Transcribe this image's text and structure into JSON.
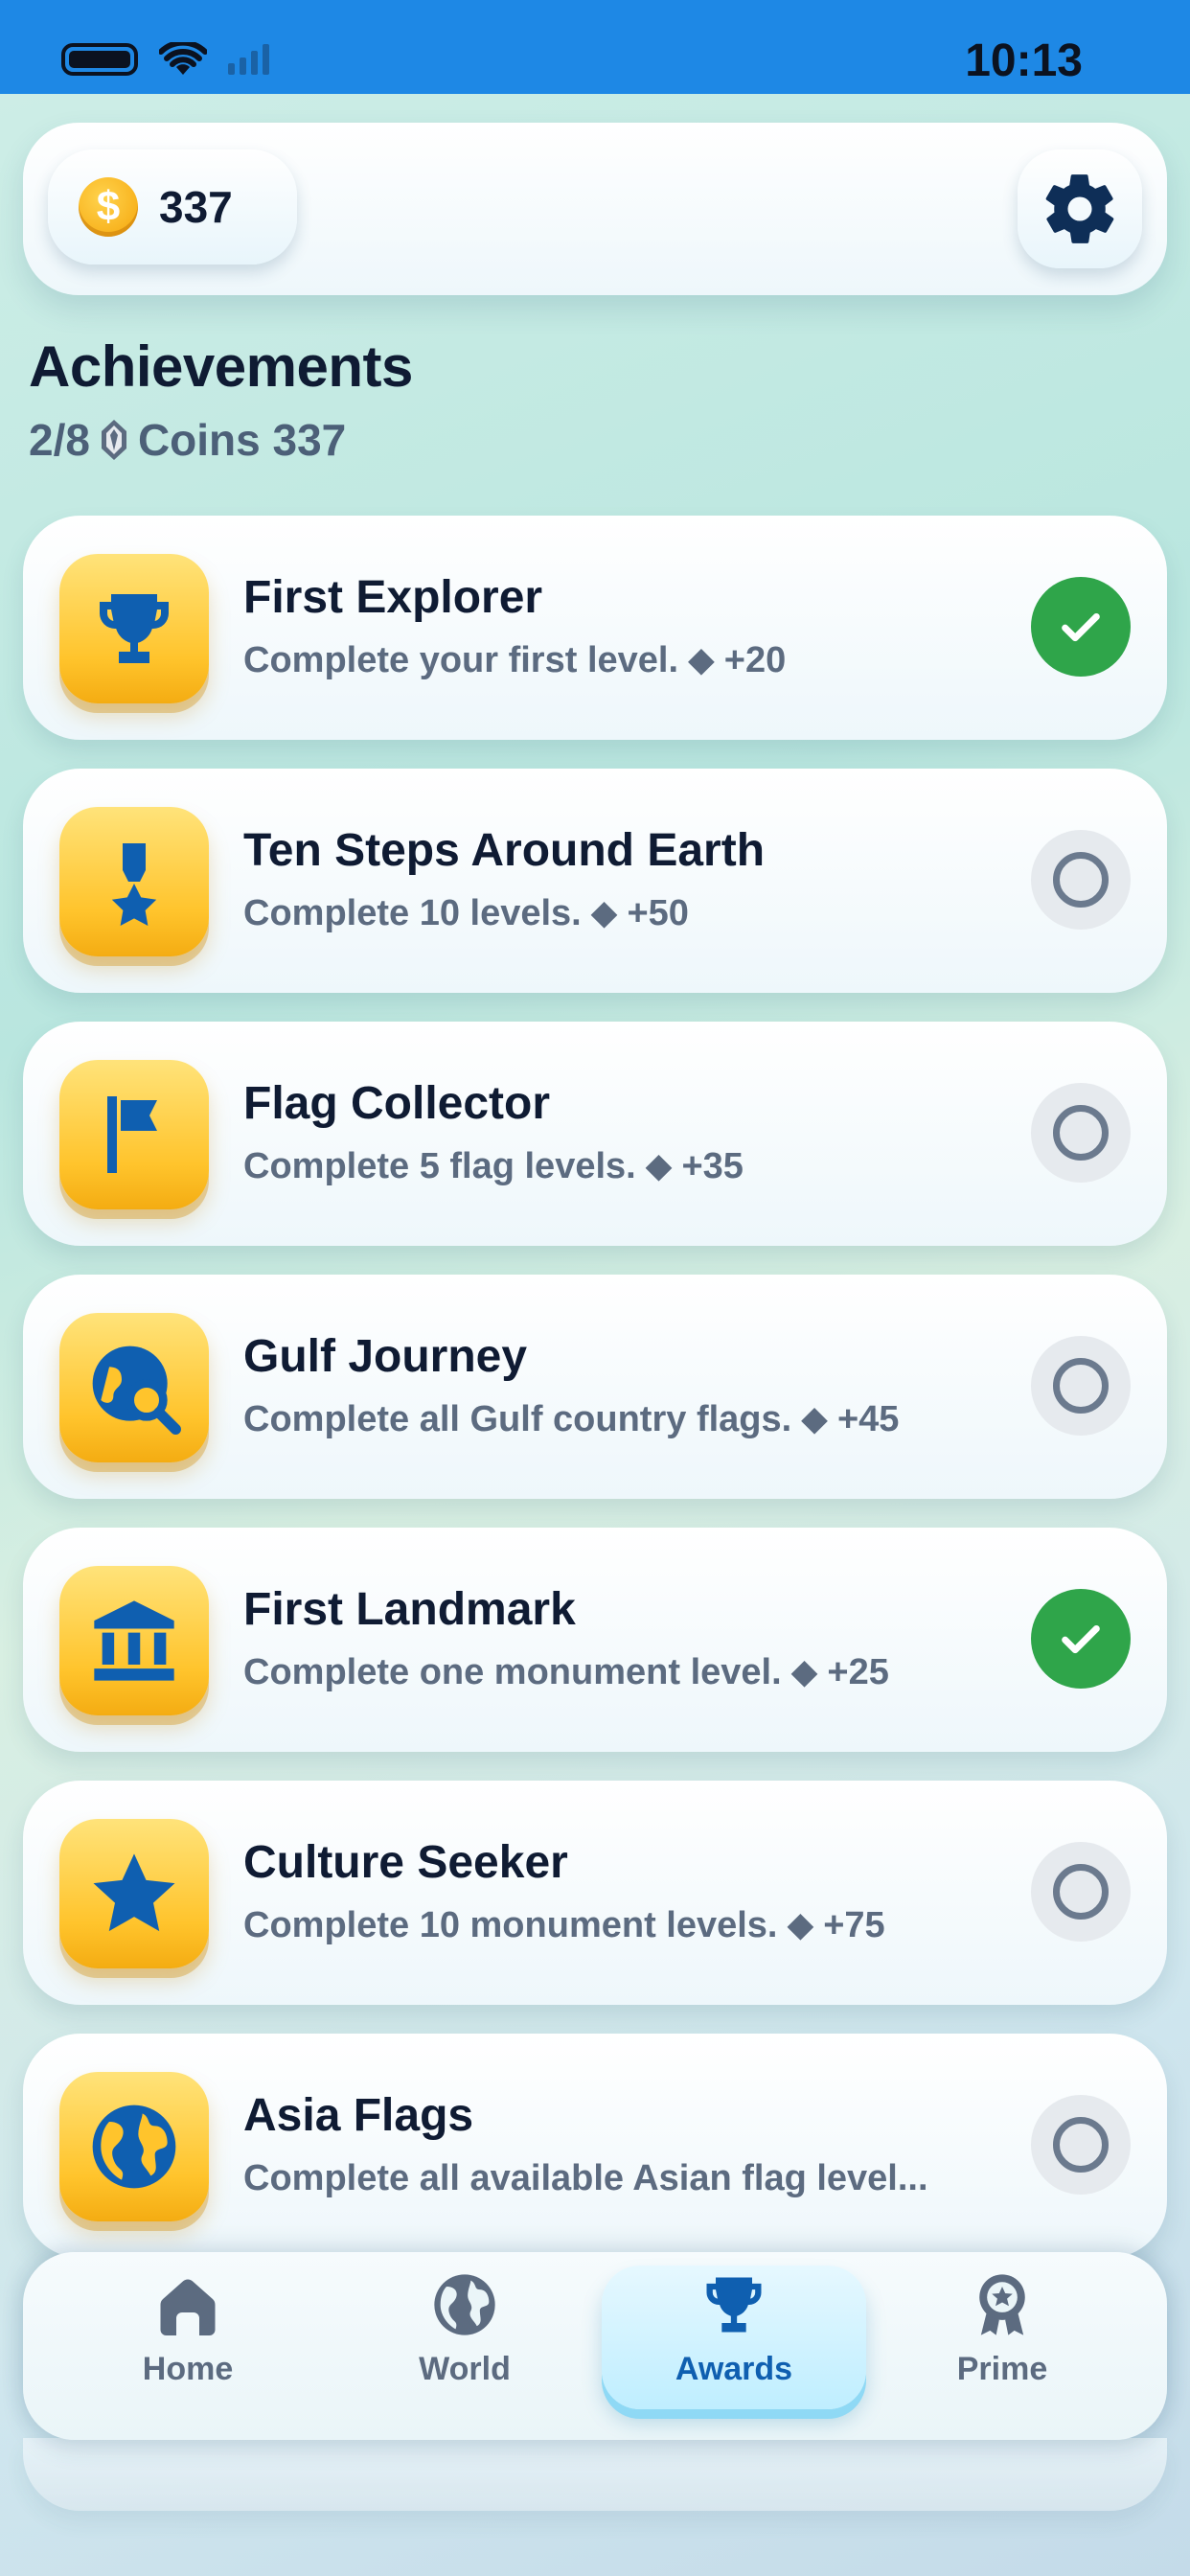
{
  "status_bar": {
    "time": "10:13"
  },
  "header": {
    "coins": "337"
  },
  "page": {
    "title": "Achievements",
    "progress": "2/8",
    "coins_label": "Coins 337"
  },
  "achievements": [
    {
      "title": "First Explorer",
      "desc": "Complete your first level.",
      "reward": "+20",
      "icon": "trophy-icon",
      "completed": true
    },
    {
      "title": "Ten Steps Around Earth",
      "desc": "Complete 10 levels.",
      "reward": "+50",
      "icon": "medal-icon",
      "completed": false
    },
    {
      "title": "Flag Collector",
      "desc": "Complete 5 flag levels.",
      "reward": "+35",
      "icon": "flag-icon",
      "completed": false
    },
    {
      "title": "Gulf Journey",
      "desc": "Complete all Gulf country flags.",
      "reward": "+45",
      "icon": "globe-search-icon",
      "completed": false
    },
    {
      "title": "First Landmark",
      "desc": "Complete one monument level.",
      "reward": "+25",
      "icon": "landmark-icon",
      "completed": true
    },
    {
      "title": "Culture Seeker",
      "desc": "Complete 10 monument levels.",
      "reward": "+75",
      "icon": "star-icon",
      "completed": false
    },
    {
      "title": "Asia Flags",
      "desc": "Complete all available Asian flag level...",
      "reward": "",
      "icon": "globe-icon",
      "completed": false
    }
  ],
  "nav": {
    "home": "Home",
    "world": "World",
    "awards": "Awards",
    "prime": "Prime"
  },
  "colors": {
    "status_bar": "#1e88e5",
    "accent_blue": "#0f5fb0",
    "icon_yellow": "#ffc42c",
    "success_green": "#2fa54a"
  }
}
